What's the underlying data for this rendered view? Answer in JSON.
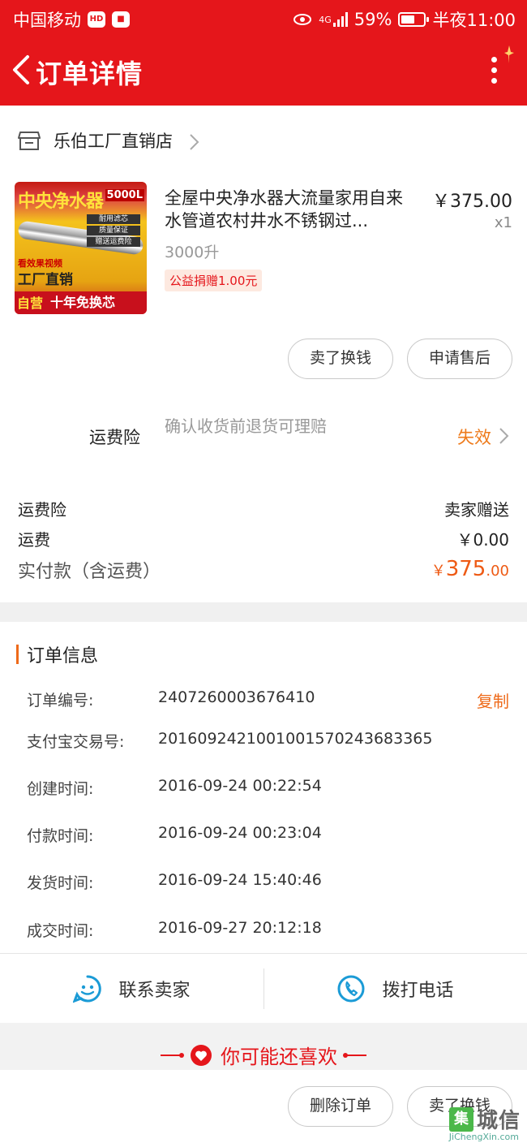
{
  "status_bar": {
    "carrier": "中国移动",
    "badges": [
      "HD",
      "📷"
    ],
    "network": "4G",
    "battery": "59%",
    "time": "半夜11:00"
  },
  "nav": {
    "title": "订单详情",
    "back_icon": "chevron-left-icon",
    "menu_icon": "more-vertical-icon"
  },
  "shop": {
    "name": "乐伯工厂直销店",
    "icon": "store-icon"
  },
  "product": {
    "title": "全屋中央净水器大流量家用自来水管道农村井水不锈钢过...",
    "price": "￥375.00",
    "quantity": "x1",
    "spec": "3000升",
    "charity": "公益捐赠1.00元",
    "image_text": {
      "headline": "中央净水器",
      "capacity": "5000L",
      "chips": [
        "耐用滤芯",
        "质量保证",
        "赠送运费险"
      ],
      "video": "看效果视频",
      "factory": "工厂直销",
      "stamp": "自营",
      "guarantee": "十年免换芯"
    }
  },
  "item_actions": {
    "sell_label": "卖了换钱",
    "after_sale_label": "申请售后"
  },
  "insurance": {
    "label": "运费险",
    "desc": "确认收货前退货可理赔",
    "status": "失效",
    "accent": "#ee7a1a"
  },
  "summary": {
    "rows": [
      {
        "label": "运费险",
        "value": "卖家赠送"
      },
      {
        "label": "运费",
        "value": "￥0.00"
      }
    ],
    "total_label": "实付款（含运费）",
    "total_yen": "￥",
    "total_int": "375",
    "total_dec": ".00"
  },
  "order_info": {
    "title": "订单信息",
    "copy_label": "复制",
    "rows": [
      {
        "label": "订单编号:",
        "value": "2407260003676410"
      },
      {
        "label": "支付宝交易号:",
        "value": "2016092421001001570243683365"
      },
      {
        "label": "创建时间:",
        "value": "2016-09-24 00:22:54"
      },
      {
        "label": "付款时间:",
        "value": "2016-09-24 00:23:04"
      },
      {
        "label": "发货时间:",
        "value": "2016-09-24 15:40:46"
      },
      {
        "label": "成交时间:",
        "value": "2016-09-27 20:12:18"
      }
    ]
  },
  "contact": {
    "seller_label": "联系卖家",
    "phone_label": "拨打电话",
    "icon_color": "#1b9bd6"
  },
  "recommend": {
    "title": "你可能还喜欢"
  },
  "bottom_actions": {
    "delete_label": "删除订单",
    "sell_label": "卖了换钱"
  },
  "watermark": {
    "box": "集",
    "text": "城信",
    "url": "JiChengXin.com"
  },
  "colors": {
    "brand_red": "#e5161b",
    "accent_orange": "#ee6a1a"
  }
}
